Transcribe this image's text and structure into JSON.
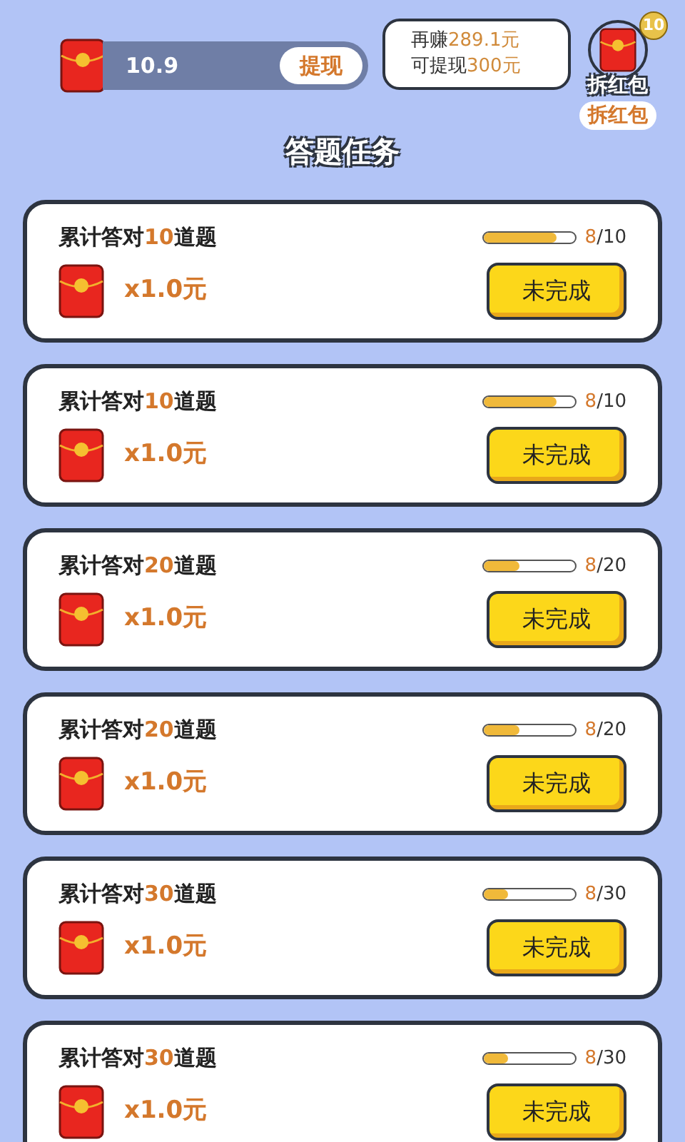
{
  "balance": {
    "amount": "10.9",
    "withdraw_button": "提现"
  },
  "bubble": {
    "line1_before": "再赚",
    "line1_value": "289.1元",
    "line2_before": "可提现",
    "line2_value": "300元"
  },
  "red_packet": {
    "badge": "10",
    "caption": "拆红包",
    "button": "拆红包"
  },
  "heading": "答题任务",
  "tasks": [
    {
      "title_before": "累计答对",
      "title_count": "10",
      "title_after": "道题",
      "level": 0.8,
      "done": "8",
      "total": "/10",
      "reward": "x1.0元",
      "button": "未完成"
    },
    {
      "title_before": "累计答对",
      "title_count": "10",
      "title_after": "道题",
      "level": 0.8,
      "done": "8",
      "total": "/10",
      "reward": "x1.0元",
      "button": "未完成"
    },
    {
      "title_before": "累计答对",
      "title_count": "20",
      "title_after": "道题",
      "level": 0.4,
      "done": "8",
      "total": "/20",
      "reward": "x1.0元",
      "button": "未完成"
    },
    {
      "title_before": "累计答对",
      "title_count": "20",
      "title_after": "道题",
      "level": 0.4,
      "done": "8",
      "total": "/20",
      "reward": "x1.0元",
      "button": "未完成"
    },
    {
      "title_before": "累计答对",
      "title_count": "30",
      "title_after": "道题",
      "level": 0.27,
      "done": "8",
      "total": "/30",
      "reward": "x1.0元",
      "button": "未完成"
    },
    {
      "title_before": "累计答对",
      "title_count": "30",
      "title_after": "道题",
      "level": 0.27,
      "done": "8",
      "total": "/30",
      "reward": "x1.0元",
      "button": "未完成"
    }
  ]
}
